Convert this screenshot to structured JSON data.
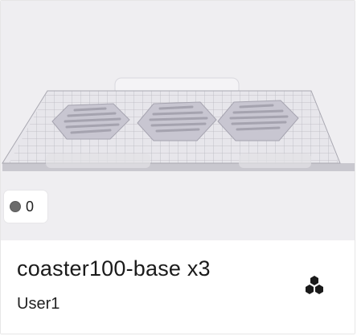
{
  "card": {
    "title": "coaster100-base x3",
    "owner": "User1",
    "color_count": "0",
    "color_swatch": "#6b6b6b",
    "thumbnail_background": "#efeef1",
    "plate_color": "#e4e3e8",
    "part_color": "#c9c7d2",
    "parts_icon": "hexagon-cluster-icon"
  }
}
